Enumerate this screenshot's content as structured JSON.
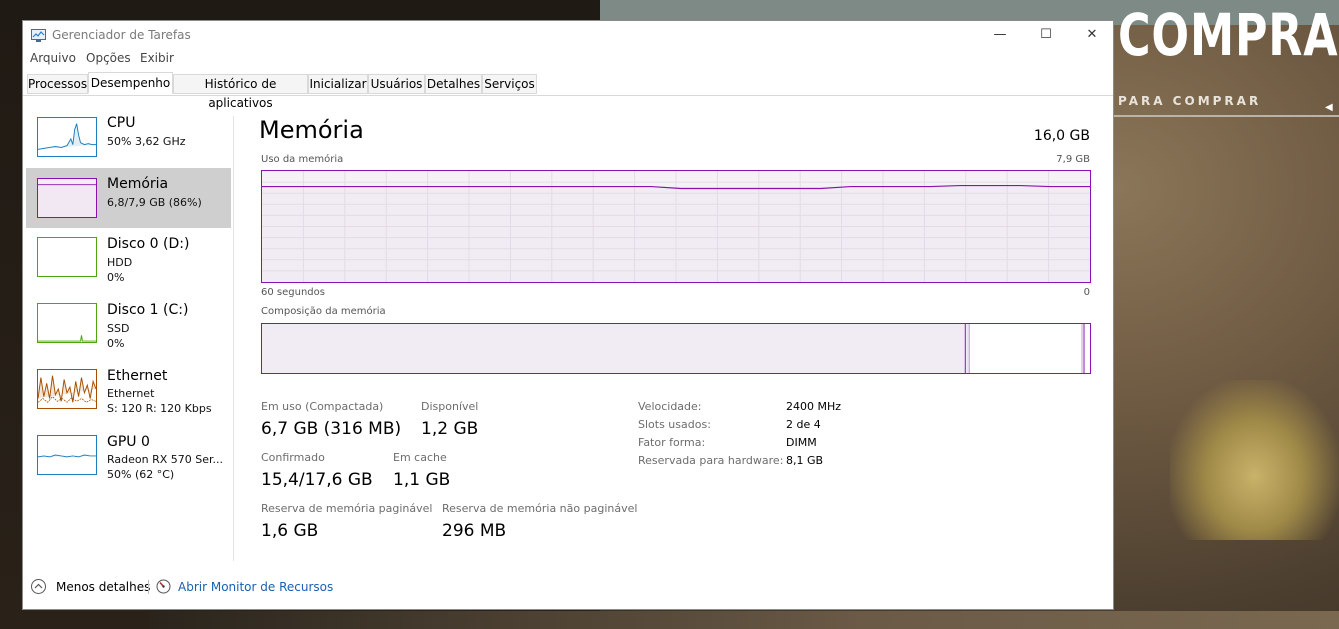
{
  "background": {
    "title": "COMPRA",
    "subtitle": "PARA COMPRAR"
  },
  "window": {
    "title": "Gerenciador de Tarefas",
    "controls": {
      "minimize": "—",
      "maximize": "☐",
      "close": "✕"
    }
  },
  "menu": [
    "Arquivo",
    "Opções",
    "Exibir"
  ],
  "tabs": [
    "Processos",
    "Desempenho",
    "Histórico de aplicativos",
    "Inicializar",
    "Usuários",
    "Detalhes",
    "Serviços"
  ],
  "active_tab": "Desempenho",
  "sidebar": [
    {
      "name": "CPU",
      "line1": "50% 3,62 GHz",
      "line2": "",
      "color": "#1b7fbd"
    },
    {
      "name": "Memória",
      "line1": "6,8/7,9 GB (86%)",
      "line2": "",
      "color": "#8b12ae"
    },
    {
      "name": "Disco 0 (D:)",
      "line1": "HDD",
      "line2": "0%",
      "color": "#4da60c"
    },
    {
      "name": "Disco 1 (C:)",
      "line1": "SSD",
      "line2": "0%",
      "color": "#4da60c"
    },
    {
      "name": "Ethernet",
      "line1": "Ethernet",
      "line2": "S: 120 R: 120 Kbps",
      "color": "#a74f01"
    },
    {
      "name": "GPU 0",
      "line1": "Radeon RX 570 Ser...",
      "line2": "50% (62 °C)",
      "color": "#1b7fbd"
    }
  ],
  "main": {
    "title": "Memória",
    "total": "16,0 GB",
    "usage_label": "Uso da memória",
    "usage_max": "7,9 GB",
    "time_left": "60 segundos",
    "time_right": "0",
    "composition_label": "Composição da memória",
    "usage_level": 0.86,
    "stats": {
      "in_use_label": "Em uso (Compactada)",
      "in_use_value": "6,7 GB (316 MB)",
      "available_label": "Disponível",
      "available_value": "1,2 GB",
      "committed_label": "Confirmado",
      "committed_value": "15,4/17,6 GB",
      "cached_label": "Em cache",
      "cached_value": "1,1 GB",
      "paged_label": "Reserva de memória paginável",
      "paged_value": "1,6 GB",
      "nonpaged_label": "Reserva de memória não paginável",
      "nonpaged_value": "296 MB"
    },
    "properties": [
      {
        "key": "Velocidade:",
        "value": "2400 MHz"
      },
      {
        "key": "Slots usados:",
        "value": "2 de 4"
      },
      {
        "key": "Fator forma:",
        "value": "DIMM"
      },
      {
        "key": "Reservada para hardware:",
        "value": "8,1 GB"
      }
    ]
  },
  "footer": {
    "less_details": "Menos detalhes",
    "open_monitor": "Abrir Monitor de Recursos"
  }
}
